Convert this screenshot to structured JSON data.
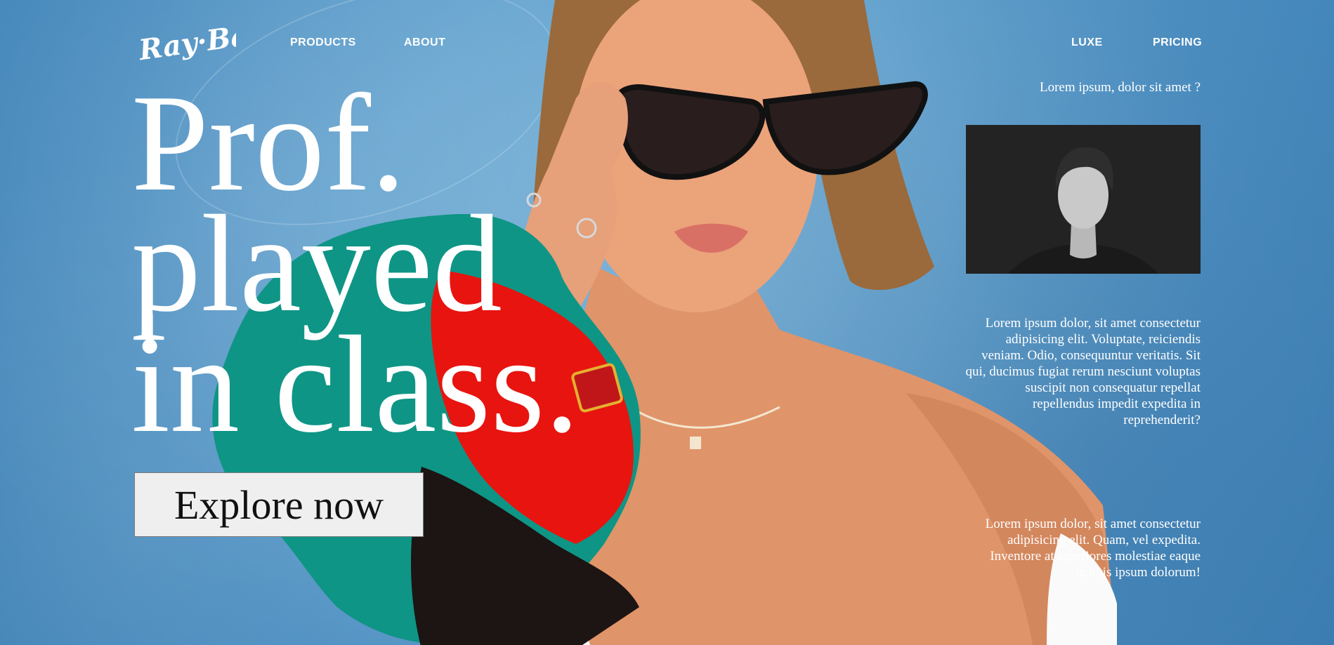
{
  "brand": {
    "logo_text": "Ray-Ban"
  },
  "nav": {
    "left": [
      {
        "label": "PRODUCTS"
      },
      {
        "label": "ABOUT"
      }
    ],
    "right": [
      {
        "label": "LUXE"
      },
      {
        "label": "PRICING"
      }
    ]
  },
  "hero": {
    "headline_lines": [
      "Prof.",
      "played",
      "in class."
    ],
    "cta_label": "Explore now"
  },
  "sidebar": {
    "tagline": "Lorem ipsum, dolor sit amet ?",
    "paragraph_1": "Lorem ipsum dolor, sit amet consectetur adipisicing elit. Voluptate, reiciendis veniam. Odio, consequuntur veritatis. Sit qui, ducimus fugiat rerum nesciunt voluptas suscipit non consequatur repellat repellendus impedit expedita in reprehenderit?",
    "paragraph_2": "Lorem ipsum dolor, sit amet consectetur adipisicing elit. Quam, vel expedita. Inventore at asperiores molestiae eaque debitis ipsum dolorum!"
  },
  "colors": {
    "background": "#5d9dcc",
    "accent_teal": "#0e9585",
    "accent_red": "#e8140f",
    "text": "#ffffff",
    "button_bg": "#efefef"
  }
}
